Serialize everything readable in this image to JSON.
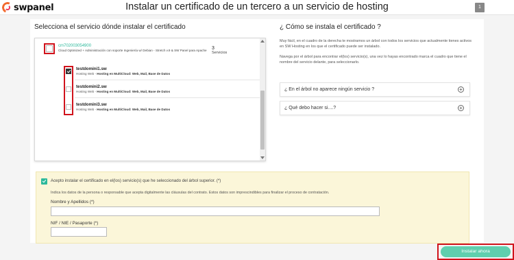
{
  "app": {
    "logo_text": "swpanel",
    "title": "Instalar un certificado de un tercero a un servicio de hosting",
    "help_label": "1"
  },
  "left": {
    "title": "Selecciona el servicio dónde instalar el certificado",
    "server": {
      "id": "cm702003054900",
      "description": "Cloud Optimized + Administración con soporte Ingeniería w/ Debian - Stretch v.9 & SW Panel para Apache",
      "count": "3",
      "count_label": "Servicios",
      "checked": false
    },
    "services": [
      {
        "name": "testdomini1.sw",
        "type": "Hosting Web - ",
        "detail": "Hosting en MultiCloud: Web, Mail, Base de Datos",
        "checked": true
      },
      {
        "name": "testdomini2.sw",
        "type": "Hosting Web - ",
        "detail": "Hosting en MultiCloud: Web, Mail, Base de Datos",
        "checked": false
      },
      {
        "name": "testdomini3.sw",
        "type": "Hosting Web - ",
        "detail": "Hosting en MultiCloud: Web, Mail, Base de Datos",
        "checked": false
      }
    ]
  },
  "right": {
    "title": "¿ Cómo se instala el certificado ?",
    "para1": "Muy fácil, en el cuadro de la derecha te mostramos un árbol con todos los servicios que actualmente tienes activos en SW Hosting en los que el certificado puede ser instalado.",
    "para2": "Navega por el árbol para encontrar el(los) servicio(s), una vez lo hayas encontrado marca el cuadro que tiene el nombre del servicio delante, para seleccionarlo.",
    "faq": [
      {
        "label": "¿ En el árbol no aparece ningún servicio ?",
        "icon": "+"
      },
      {
        "label": "¿ Qué debo hacer si....?",
        "icon": "+"
      }
    ]
  },
  "consent": {
    "accept_text": "Acepto instalar el certificado en el(los) servicio(s) que he seleccionado del árbol superior. (*)",
    "sub_text": "Indica los datos de la persona o responsable que acepta digitalmente las cláusulas del contrato. Estos datos son imprescindibles para finalizar el proceso de contratación.",
    "name_label": "Nombre y Apellidos (*)",
    "name_value": "",
    "nif_label": "NIF / NIE / Pasaporte (*)",
    "nif_value": "",
    "checked": true
  },
  "actions": {
    "install_label": "Instalar ahora"
  },
  "colors": {
    "accent": "#2db99b",
    "button": "#5fcfae",
    "highlight": "#d0121b",
    "consent_bg": "#fbf6d9"
  }
}
